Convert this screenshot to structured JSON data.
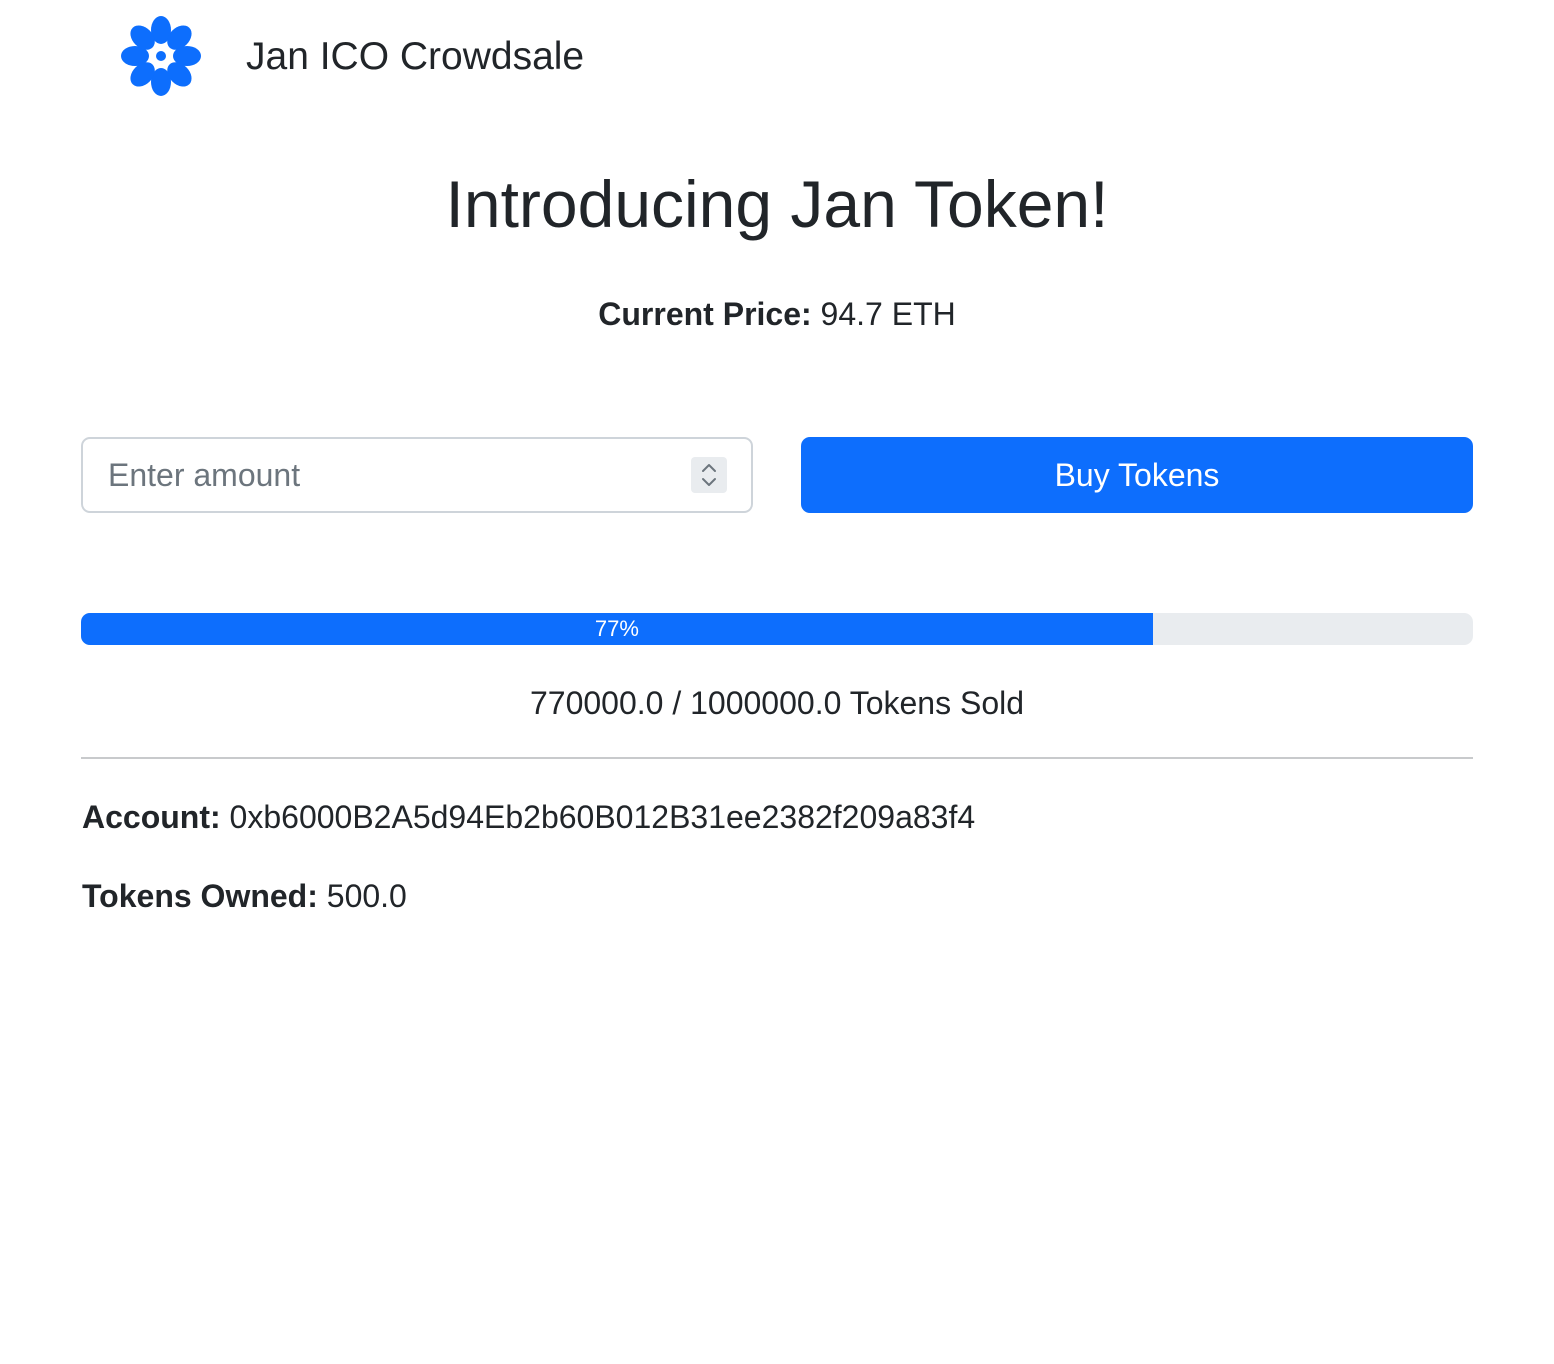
{
  "header": {
    "logo_icon": "flower-icon",
    "title": "Jan ICO Crowdsale"
  },
  "hero": {
    "title": "Introducing Jan Token!"
  },
  "price": {
    "label": "Current Price:",
    "value": "94.7 ETH"
  },
  "purchase": {
    "amount_placeholder": "Enter amount",
    "amount_value": "",
    "buy_label": "Buy Tokens"
  },
  "progress": {
    "percent": 77,
    "label": "77%"
  },
  "sales": {
    "text": "770000.0 / 1000000.0 Tokens Sold"
  },
  "account": {
    "label": "Account:",
    "value": "0xb6000B2A5d94Eb2b60B012B31ee2382f209a83f4"
  },
  "tokens_owned": {
    "label": "Tokens Owned:",
    "value": "500.0"
  },
  "colors": {
    "primary": "#0d6efd",
    "text": "#212529",
    "track": "#e9ecef"
  }
}
